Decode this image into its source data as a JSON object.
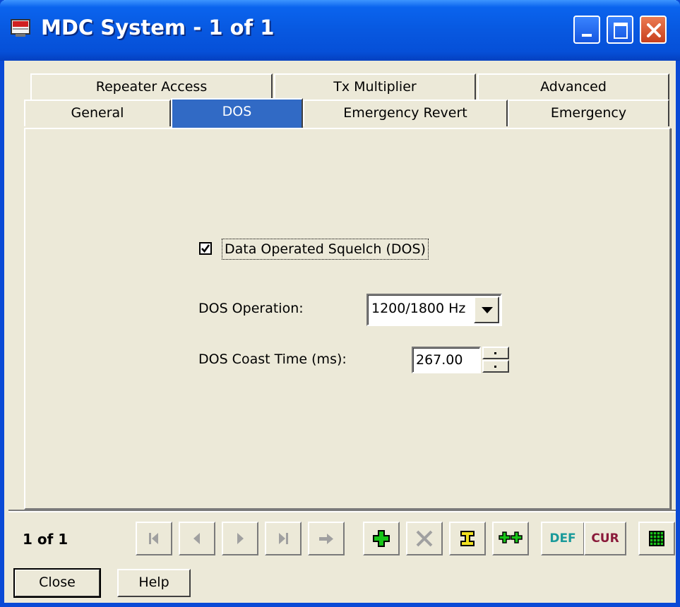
{
  "window": {
    "title": "MDC System - 1 of 1"
  },
  "tabs_row1": [
    "Repeater Access",
    "Tx Multiplier",
    "Advanced"
  ],
  "tabs_row2": [
    "General",
    "DOS",
    "Emergency Revert",
    "Emergency"
  ],
  "active_tab": "DOS",
  "dos": {
    "checkbox_label": "Data Operated Squelch (DOS)",
    "checkbox_checked": true,
    "operation_label": "DOS Operation:",
    "operation_value": "1200/1800 Hz",
    "coast_label": "DOS Coast Time (ms):",
    "coast_value": "267.00"
  },
  "status": {
    "record_count": "1 of 1"
  },
  "toolbar": {
    "def_label": "DEF",
    "cur_label": "CUR",
    "icons": [
      "first-record-icon",
      "previous-record-icon",
      "next-record-icon",
      "last-record-icon",
      "goto-record-icon",
      "add-record-icon",
      "delete-record-icon",
      "insert-record-icon",
      "duplicate-record-icon",
      "default-values-icon",
      "current-values-icon",
      "spreadsheet-view-icon"
    ]
  },
  "buttons": {
    "close": "Close",
    "help": "Help"
  }
}
